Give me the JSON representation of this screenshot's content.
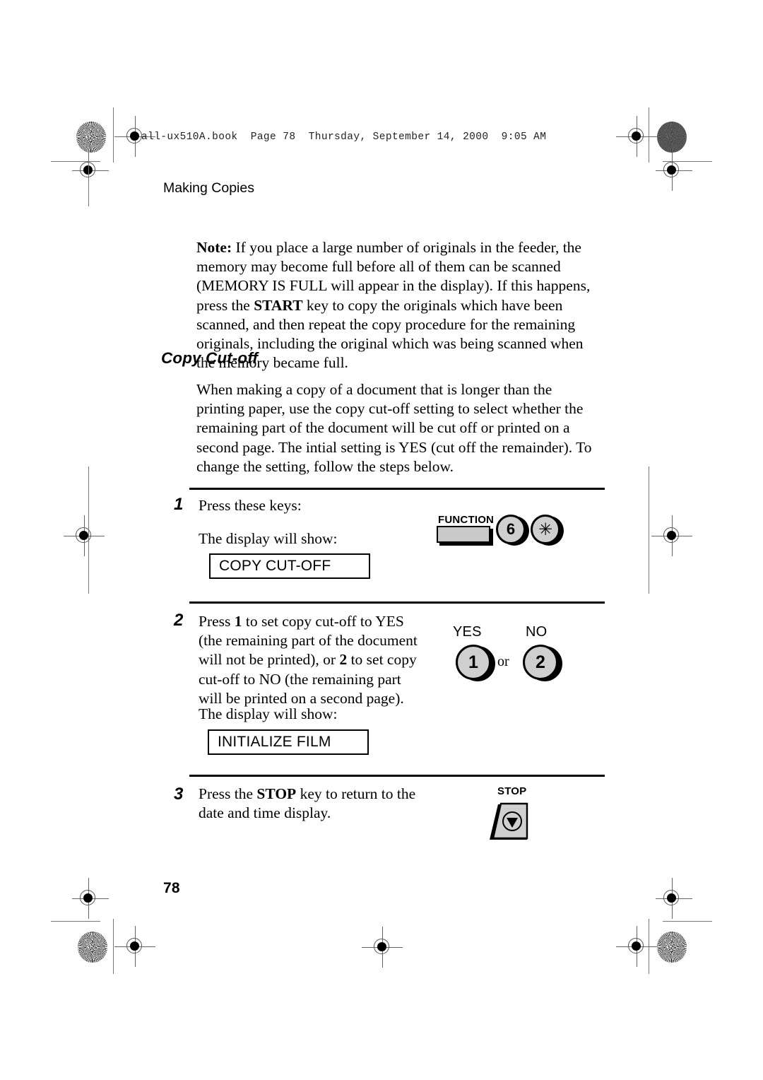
{
  "header": {
    "book_tag": "all-ux510A.book  Page 78  Thursday, September 14, 2000  9:05 AM",
    "running_head": "Making Copies"
  },
  "note": {
    "label": "Note:",
    "body_1": " If you place a large number of originals in the feeder, the memory may become full before all of them can be scanned (MEMORY IS FULL will appear in the display). If this happens, press the ",
    "bold_key": "START",
    "body_2": " key to copy the originals which have been scanned, and then repeat the copy procedure for the remaining originals, including the original which was being scanned when the memory became full."
  },
  "section": {
    "title": "Copy Cut-off",
    "intro": "When making a copy of a document that is longer than the printing paper, use the copy cut-off setting to select whether the remaining part of the document will be cut off or printed on a second page. The intial setting is YES (cut off the remainder). To change the setting, follow the steps below."
  },
  "steps": [
    {
      "number": "1",
      "text": "Press these keys:",
      "display_prompt": "The display will show:",
      "display_value": "COPY CUT-OFF",
      "keys": {
        "function_label": "FUNCTION",
        "digit": "6",
        "asterisk": "✳"
      }
    },
    {
      "number": "2",
      "text_1": "Press ",
      "bold_1": "1",
      "text_2": " to set copy cut-off to YES (the remaining part of the document will not be printed), or ",
      "bold_2": "2",
      "text_3": " to set copy cut-off to NO (the remaining part will be printed on a second page).",
      "display_prompt": "The display will show:",
      "display_value": "INITIALIZE FILM",
      "keys": {
        "yes_label": "YES",
        "no_label": "NO",
        "yes_key": "1",
        "or_label": "or",
        "no_key": "2"
      }
    },
    {
      "number": "3",
      "text_1": "Press the ",
      "bold_1": "STOP",
      "text_2": " key to return to the date and time display.",
      "keys": {
        "stop_label": "STOP"
      }
    }
  ],
  "footer": {
    "page_number": "78"
  },
  "colors": {
    "key_fill": "#cfcfcf",
    "function_fill": "#c9c9c9",
    "ink": "#000000",
    "paper": "#ffffff"
  }
}
